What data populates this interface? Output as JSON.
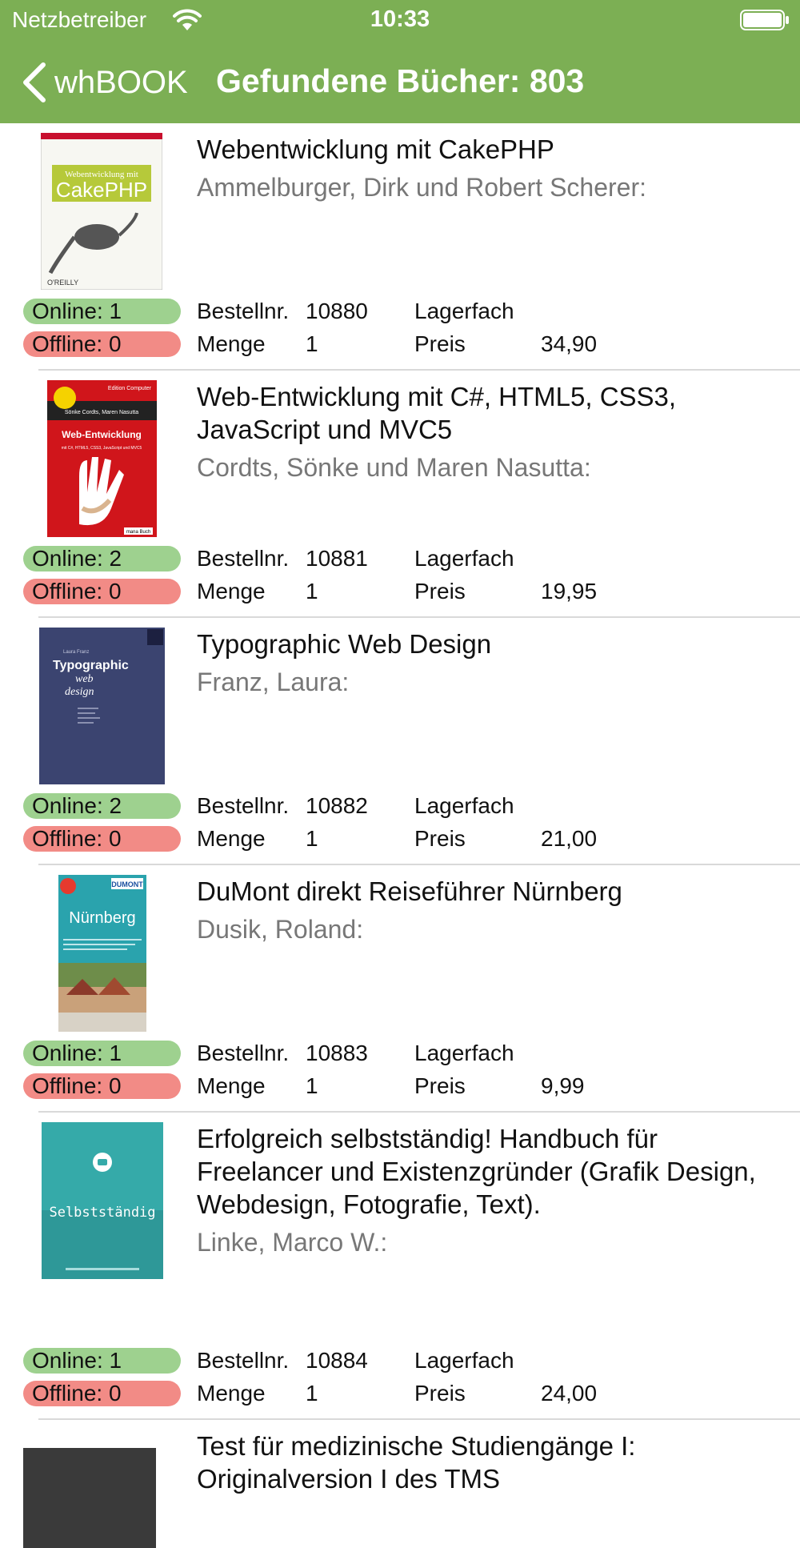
{
  "status_bar": {
    "carrier": "Netzbetreiber",
    "time": "10:33"
  },
  "nav": {
    "back_label": "whBOOK",
    "title": "Gefundene Bücher: 803"
  },
  "colors": {
    "header": "#7caf54",
    "online": "#9ed18f",
    "offline": "#f28b86"
  },
  "labels": {
    "order_no": "Bestellnr.",
    "quantity": "Menge",
    "shelf": "Lagerfach",
    "price": "Preis"
  },
  "books": [
    {
      "title": "Webentwicklung mit CakePHP",
      "author": "Ammelburger, Dirk und Robert Scherer:",
      "online": "Online: 1",
      "offline": "Offline: 0",
      "order_no": "10880",
      "quantity": "1",
      "shelf": "",
      "price": "34,90",
      "cover_text": [
        "Webentwicklung mit",
        "CakePHP",
        "O'REILLY"
      ]
    },
    {
      "title": "Web-Entwicklung mit C#, HTML5, CSS3, JavaScript und MVC5",
      "author": "Cordts, Sönke und Maren Nasutta:",
      "online": "Online: 2",
      "offline": "Offline: 0",
      "order_no": "10881",
      "quantity": "1",
      "shelf": "",
      "price": "19,95",
      "cover_text": [
        "Edition Computer",
        "Sönke Cordts, Maren Nasutta",
        "Web-Entwicklung",
        "mit C#, HTML5, CSS3, JavaScript und MVC5",
        "mana Buch"
      ]
    },
    {
      "title": "Typographic Web Design",
      "author": "Franz, Laura:",
      "online": "Online: 2",
      "offline": "Offline: 0",
      "order_no": "10882",
      "quantity": "1",
      "shelf": "",
      "price": "21,00",
      "cover_text": [
        "Laura Franz",
        "Typographic",
        "web",
        "design"
      ]
    },
    {
      "title": "DuMont direkt Reiseführer Nürnberg",
      "author": "Dusik, Roland:",
      "online": "Online: 1",
      "offline": "Offline: 0",
      "order_no": "10883",
      "quantity": "1",
      "shelf": "",
      "price": "9,99",
      "cover_text": [
        "DUMONT",
        "Nürnberg"
      ]
    },
    {
      "title": "Erfolgreich selbstständig! Handbuch für Freelancer und Existenzgründer (Grafik Design, Webdesign, Fotografie, Text).",
      "author": "Linke, Marco W.:",
      "online": "Online: 1",
      "offline": "Offline: 0",
      "order_no": "10884",
      "quantity": "1",
      "shelf": "",
      "price": "24,00",
      "cover_text": [
        "Selbstständig"
      ]
    },
    {
      "title": "Test für medizinische Studiengänge I: Originalversion I des TMS",
      "author": "",
      "online": "",
      "offline": "",
      "order_no": "",
      "quantity": "",
      "shelf": "",
      "price": ""
    }
  ]
}
